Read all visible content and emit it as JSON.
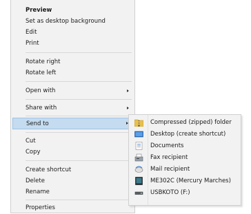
{
  "context_menu": {
    "items": [
      {
        "label": "Preview"
      },
      {
        "label": "Set as desktop background"
      },
      {
        "label": "Edit"
      },
      {
        "label": "Print"
      },
      {
        "label": "Rotate right"
      },
      {
        "label": "Rotate left"
      },
      {
        "label": "Open with"
      },
      {
        "label": "Share with"
      },
      {
        "label": "Send to"
      },
      {
        "label": "Cut"
      },
      {
        "label": "Copy"
      },
      {
        "label": "Create shortcut"
      },
      {
        "label": "Delete"
      },
      {
        "label": "Rename"
      },
      {
        "label": "Properties"
      }
    ]
  },
  "send_to_menu": {
    "items": [
      {
        "label": "Compressed (zipped) folder",
        "icon": "zip-folder-icon"
      },
      {
        "label": "Desktop (create shortcut)",
        "icon": "desktop-icon"
      },
      {
        "label": "Documents",
        "icon": "documents-icon"
      },
      {
        "label": "Fax recipient",
        "icon": "fax-icon"
      },
      {
        "label": "Mail recipient",
        "icon": "mail-icon"
      },
      {
        "label": "ME302C (Mercury Marches)",
        "icon": "device-icon"
      },
      {
        "label": "USBKOTO (F:)",
        "icon": "usb-drive-icon"
      }
    ]
  },
  "colors": {
    "menu_background": "#f2f2f2",
    "highlight": "#c5dbf0",
    "highlight_border": "#9cc3e6"
  }
}
